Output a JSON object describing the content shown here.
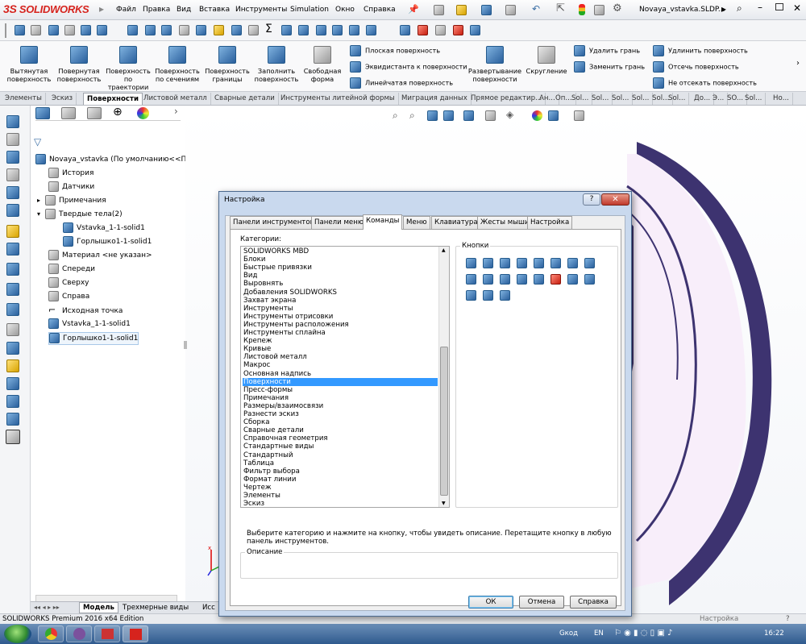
{
  "app": {
    "logo": "SOLIDWORKS",
    "logo_prefix": "3S",
    "menus": [
      "Файл",
      "Правка",
      "Вид",
      "Вставка",
      "Инструменты",
      "Simulation",
      "Окно",
      "Справка"
    ],
    "doc_title": "Novaya_vstavka.SLDP..."
  },
  "ribbon": {
    "large_buttons": [
      "Вытянутая поверхность",
      "Повернутая поверхность",
      "Поверхность по траектории",
      "Поверхность по сечениям",
      "Поверхность границы",
      "Заполнить поверхность",
      "Свободная форма"
    ],
    "col1": [
      "Плоская поверхность",
      "Эквидистанта к поверхности",
      "Линейчатая поверхность"
    ],
    "col2": [
      "Развертывание поверхности",
      "Скругление"
    ],
    "col3": [
      "Удалить грань",
      "Заменить грань"
    ],
    "col4": [
      "Удлинить поверхность",
      "Отсечь поверхность",
      "Не отсекать поверхность"
    ]
  },
  "tabs": [
    "Элементы",
    "Эскиз",
    "Поверхности",
    "Листовой металл",
    "Сварные детали",
    "Инструменты литейной формы",
    "Миграция данных",
    "Прямое редактир...",
    "Ан...",
    "Оп...",
    "Sol...",
    "Sol...",
    "Sol...",
    "Sol...",
    "Sol...",
    "Sol...",
    "До...",
    "Э...",
    "SO...",
    "Sol...",
    "Но..."
  ],
  "tree": {
    "root": "Novaya_vstavka  (По умолчанию<<По",
    "items": [
      "История",
      "Датчики",
      "Примечания",
      "Твердые тела(2)",
      "Vstavka_1-1-solid1",
      "Горлышко1-1-solid1",
      "Материал <не указан>",
      "Спереди",
      "Сверху",
      "Справа",
      "Исходная точка",
      "Vstavka_1-1-solid1",
      "Горлышко1-1-solid1"
    ]
  },
  "bottom_tabs": [
    "Модель",
    "Трехмерные виды",
    "Исс"
  ],
  "status": {
    "left": "SOLIDWORKS Premium 2016 x64 Edition",
    "right": "Настройка"
  },
  "taskbar": {
    "lang_label": "Gкод",
    "lang": "EN",
    "clock": "16:22"
  },
  "dialog": {
    "title": "Настройка",
    "help_btn": "?",
    "tabs": [
      "Панели инструментов",
      "Панели меню",
      "Команды",
      "Меню",
      "Клавиатура",
      "Жесты мыши",
      "Настройка"
    ],
    "categories_label": "Категории:",
    "categories": [
      "SOLIDWORKS MBD",
      "Блоки",
      "Быстрые привязки",
      "Вид",
      "Выровнять",
      "Добавления SOLIDWORKS",
      "Захват экрана",
      "Инструменты",
      "Инструменты отрисовки",
      "Инструменты расположения",
      "Инструменты сплайна",
      "Крепеж",
      "Кривые",
      "Листовой металл",
      "Макрос",
      "Основная надпись",
      "Поверхности",
      "Пресс-формы",
      "Примечания",
      "Размеры/взаимосвязи",
      "Разнести эскиз",
      "Сборка",
      "Сварные детали",
      "Справочная геометрия",
      "Стандартные виды",
      "Стандартный",
      "Таблица",
      "Фильтр выбора",
      "Формат линии",
      "Чертеж",
      "Элементы",
      "Эскиз"
    ],
    "selected_category": "Поверхности",
    "buttons_label": "Кнопки",
    "hint": "Выберите категорию и нажмите на кнопку, чтобы увидеть описание. Перетащите кнопку в любую панель инструментов.",
    "description_label": "Описание",
    "ok": "ОК",
    "cancel": "Отмена",
    "help": "Справка"
  },
  "colors": {
    "selection": "#3399ff",
    "logo": "#d6231d",
    "part_face": "#f8eefa",
    "part_edge": "#3a2f66"
  }
}
